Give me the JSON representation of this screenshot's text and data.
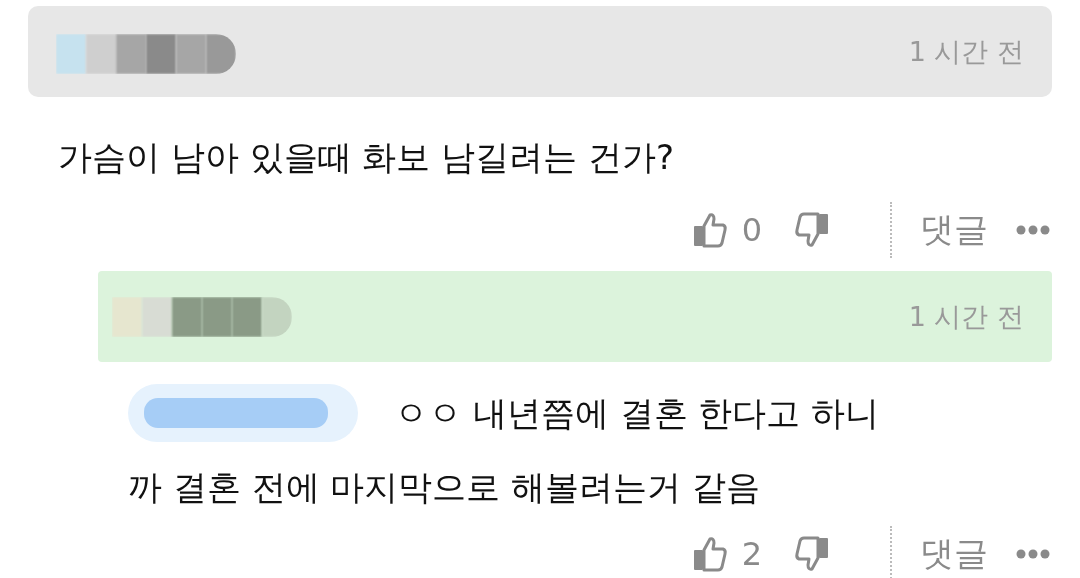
{
  "comments": [
    {
      "highlighted": false,
      "time": "1 시간 전",
      "mention": false,
      "lines": [
        "가슴이 남아 있을때 화보 남길려는 건가?"
      ],
      "likes": "0",
      "reply_label": "댓글"
    },
    {
      "highlighted": true,
      "time": "1 시간 전",
      "mention": true,
      "lines": [
        "ㅇㅇ 내년쯤에 결혼 한다고 하니",
        "까 결혼 전에 마지막으로 해볼려는거 같음"
      ],
      "likes": "2",
      "reply_label": "댓글"
    }
  ]
}
